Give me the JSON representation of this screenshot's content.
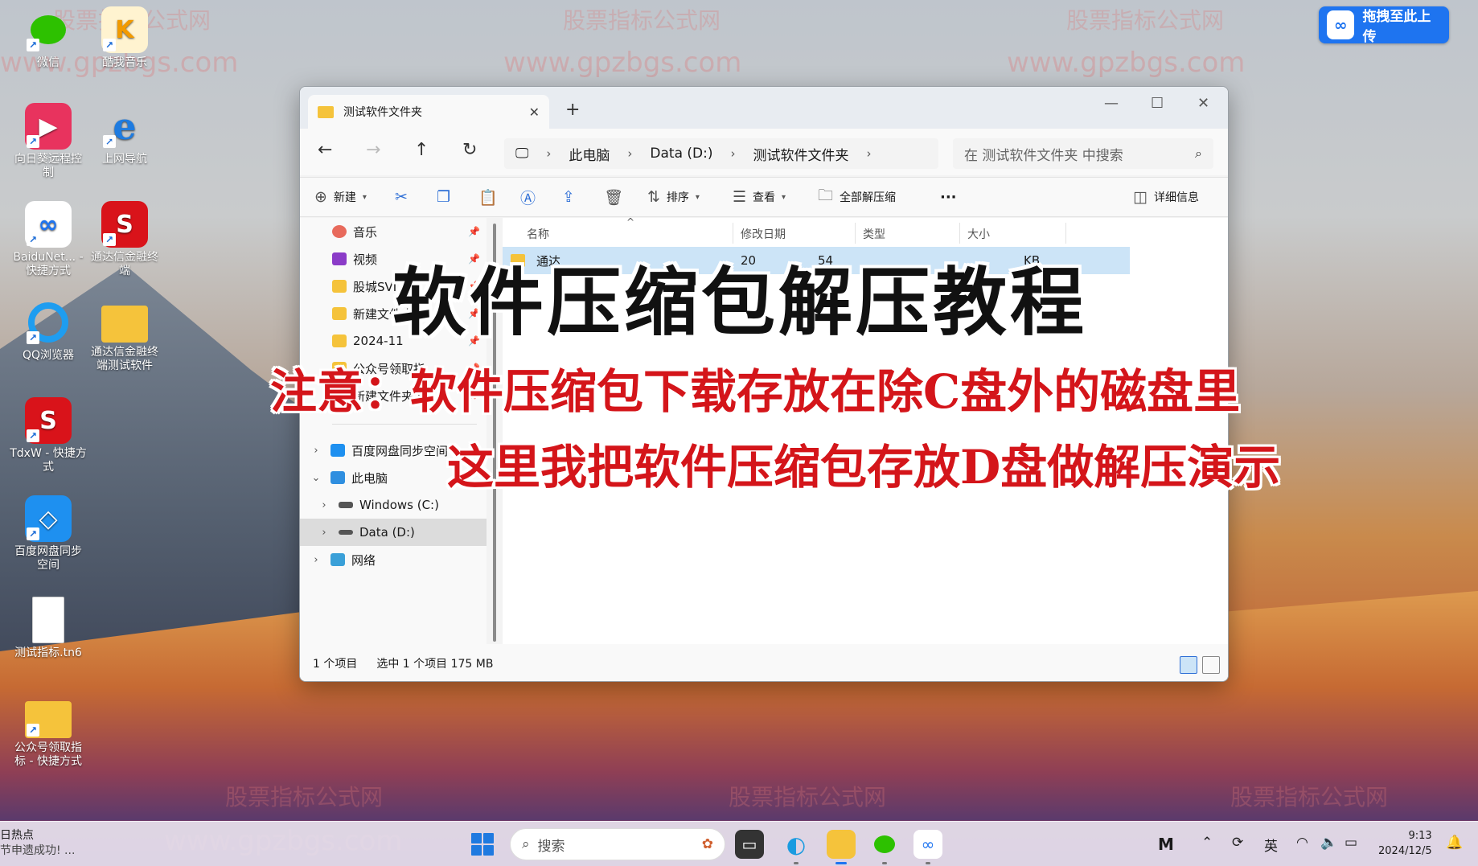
{
  "watermarks": {
    "cn": "股票指标公式网",
    "url": "www.gpzbgs.com"
  },
  "desktop": {
    "icons": [
      {
        "label": "微信"
      },
      {
        "label": "酷我音乐"
      },
      {
        "label": "向日葵远程控制"
      },
      {
        "label": "上网导航"
      },
      {
        "label": "BaiduNet... - 快捷方式"
      },
      {
        "label": "通达信金融终端"
      },
      {
        "label": "QQ浏览器"
      },
      {
        "label": "通达信金融终端测试软件"
      },
      {
        "label": "TdxW - 快捷方式"
      },
      {
        "label": "百度网盘同步空间"
      },
      {
        "label": "测试指标.tn6"
      },
      {
        "label": "公众号领取指标 - 快捷方式"
      }
    ],
    "upload_button": "拖拽至此上传"
  },
  "window": {
    "tab_title": "测试软件文件夹",
    "address": {
      "this_pc": "此电脑",
      "drive": "Data (D:)",
      "folder": "测试软件文件夹"
    },
    "search_placeholder": "在 测试软件文件夹 中搜索",
    "toolbar": {
      "new": "新建",
      "sort": "排序",
      "view": "查看",
      "extract_all": "全部解压缩",
      "more": "···",
      "details": "详细信息"
    },
    "nav": {
      "music": "音乐",
      "video": "视频",
      "gucheng": "股城SVI",
      "new_folder": "新建文件夹",
      "month": "2024-11",
      "gzh": "公众号领取指",
      "new_folder_2": "新建文件夹 (2)",
      "baidu_sync": "百度网盘同步空间",
      "this_pc": "此电脑",
      "windows_c": "Windows (C:)",
      "data_d": "Data (D:)",
      "network": "网络"
    },
    "columns": {
      "name": "名称",
      "modified": "修改日期",
      "type": "类型",
      "size": "大小"
    },
    "file_row": {
      "name": "通达",
      "date": "20",
      "time": "54",
      "size": "KB"
    },
    "status": {
      "count": "1 个项目",
      "selected": "选中 1 个项目  175 MB"
    }
  },
  "overlay": {
    "title": "软件压缩包解压教程",
    "note_line1": "注意：软件压缩包下载存放在除C盘外的磁盘里",
    "note_line2": "这里我把软件压缩包存放D盘做解压演示"
  },
  "taskbar": {
    "news_title": "日热点",
    "news_sub": "节申遗成功! ...",
    "search_placeholder": "搜索",
    "ime": "英",
    "time": "9:13",
    "date": "2024/12/5"
  }
}
